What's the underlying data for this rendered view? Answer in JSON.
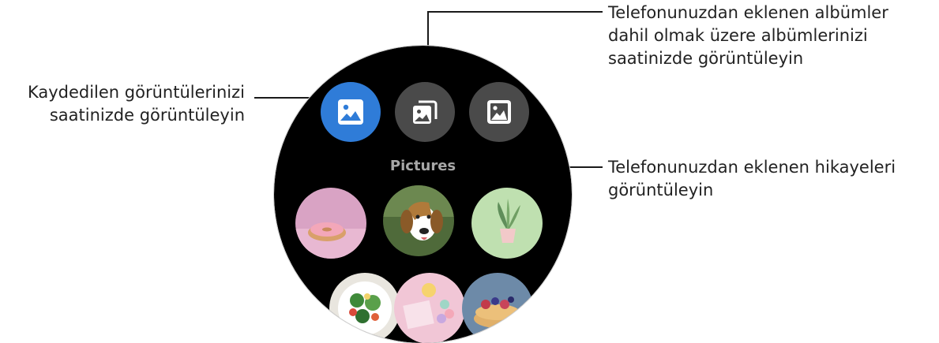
{
  "callouts": {
    "left": [
      "Kaydedilen görüntülerinizi",
      "saatinizde görüntüleyin"
    ],
    "top_right": [
      "Telefonunuzdan eklenen albümler",
      "dahil olmak üzere albümlerinizi",
      "saatinizde görüntüleyin"
    ],
    "bottom_right": [
      "Telefonunuzdan eklenen hikayeleri",
      "görüntüleyin"
    ]
  },
  "watch": {
    "tabs": [
      {
        "name": "pictures",
        "icon": "image-icon",
        "active": true,
        "color": "#2f7cd8"
      },
      {
        "name": "albums",
        "icon": "album-stack-icon",
        "active": false,
        "color": "#4a4a4a"
      },
      {
        "name": "stories",
        "icon": "story-icon",
        "active": false,
        "color": "#4a4a4a"
      }
    ],
    "section_title": "Pictures",
    "thumbnails": [
      {
        "subject": "donut"
      },
      {
        "subject": "beagle-dog"
      },
      {
        "subject": "potted-plant"
      },
      {
        "subject": "salad"
      },
      {
        "subject": "macarons"
      },
      {
        "subject": "pancakes-berries"
      }
    ]
  },
  "colors": {
    "accent": "#2f7cd8",
    "tab_inactive": "#4a4a4a",
    "leader": "#1a1a1a"
  }
}
